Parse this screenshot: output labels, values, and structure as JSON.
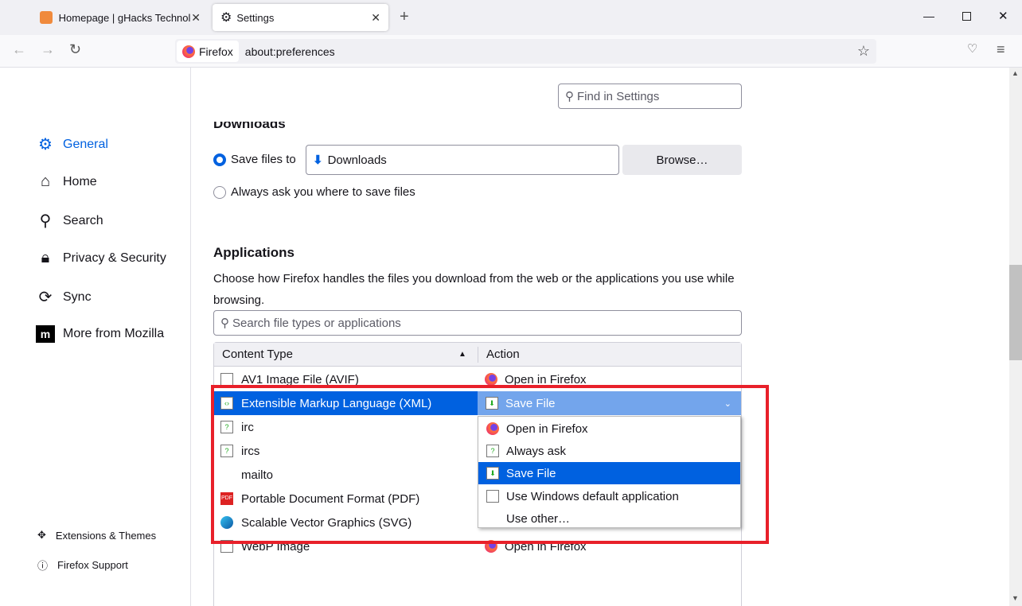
{
  "tabs": [
    {
      "title": "Homepage | gHacks Technolog",
      "icon": "ghacks-icon"
    },
    {
      "title": "Settings",
      "icon": "gear-icon",
      "active": true
    }
  ],
  "urlbar": {
    "identity": "Firefox",
    "url": "about:preferences"
  },
  "sidebar": {
    "items": [
      {
        "label": "General",
        "icon": "gear-icon",
        "active": true
      },
      {
        "label": "Home",
        "icon": "home-icon"
      },
      {
        "label": "Search",
        "icon": "search-icon"
      },
      {
        "label": "Privacy & Security",
        "icon": "lock-icon"
      },
      {
        "label": "Sync",
        "icon": "sync-icon"
      },
      {
        "label": "More from Mozilla",
        "icon": "mozilla-icon"
      }
    ],
    "footer": [
      {
        "label": "Extensions & Themes"
      },
      {
        "label": "Firefox Support"
      }
    ]
  },
  "search": {
    "placeholder": "Find in Settings"
  },
  "downloads": {
    "heading": "Downloads",
    "save_label": "Save files to",
    "folder": "Downloads",
    "browse": "Browse…",
    "ask_label": "Always ask you where to save files"
  },
  "applications": {
    "heading": "Applications",
    "description": "Choose how Firefox handles the files you download from the web or the applications you use while browsing.",
    "search_placeholder": "Search file types or applications",
    "columns": [
      "Content Type",
      "Action"
    ],
    "rows": [
      {
        "type": "AV1 Image File (AVIF)",
        "action": "Open in Firefox"
      },
      {
        "type": "Extensible Markup Language (XML)",
        "action": "Save File",
        "selected": true
      },
      {
        "type": "irc",
        "action": ""
      },
      {
        "type": "ircs",
        "action": ""
      },
      {
        "type": "mailto",
        "action": ""
      },
      {
        "type": "Portable Document Format (PDF)",
        "action": ""
      },
      {
        "type": "Scalable Vector Graphics (SVG)",
        "action": ""
      },
      {
        "type": "WebP Image",
        "action": "Open in Firefox"
      }
    ],
    "dropdown_options": [
      "Open in Firefox",
      "Always ask",
      "Save File",
      "Use Windows default application",
      "Use other…"
    ],
    "dropdown_selected": "Save File"
  },
  "colors": {
    "accent": "#0061e0",
    "highlight_box": "#e8202a"
  }
}
